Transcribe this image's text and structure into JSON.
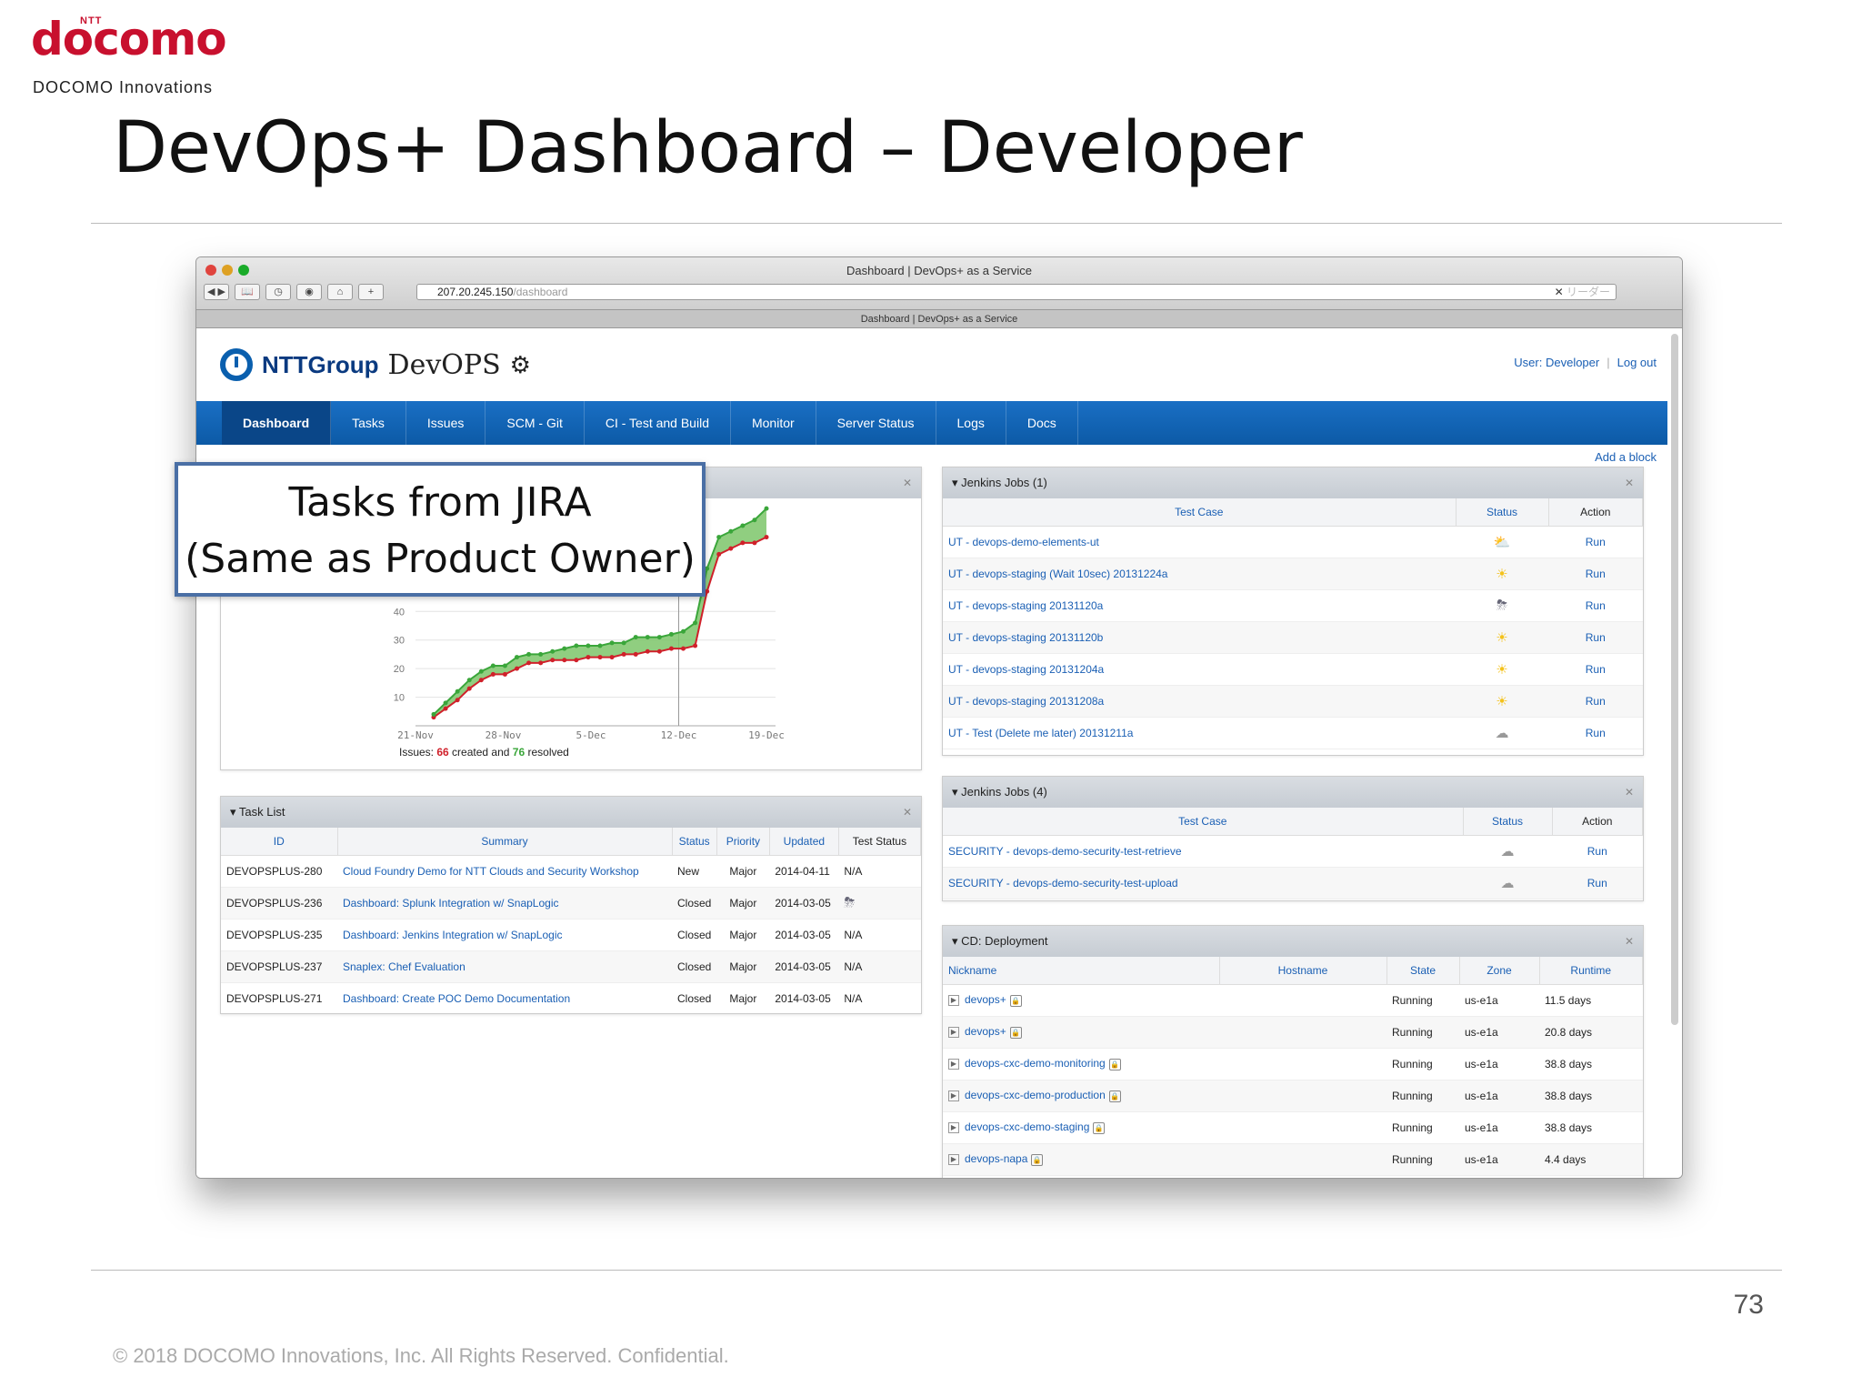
{
  "slide": {
    "logo_small": "NTT",
    "logo": "docomo",
    "logo_sub": "DOCOMO Innovations",
    "title": "DevOps+ Dashboard – Developer",
    "page_number": "73",
    "footer": "© 2018 DOCOMO Innovations, Inc. All Rights Reserved. Confidential."
  },
  "browser": {
    "window_title": "Dashboard | DevOps+ as a Service",
    "url_host": "207.20.245.150",
    "url_path": "/dashboard",
    "tab_title": "Dashboard | DevOps+ as a Service",
    "reader_label": "リーダー"
  },
  "app": {
    "brand_company": "NTTGroup",
    "brand_product": "DevOPS",
    "user_label": "User: Developer",
    "logout_label": "Log out",
    "nav": [
      "Dashboard",
      "Tasks",
      "Issues",
      "SCM - Git",
      "CI - Test and Build",
      "Monitor",
      "Server Status",
      "Logs",
      "Docs"
    ],
    "active_nav": "Dashboard",
    "add_block": "Add a block"
  },
  "callout": {
    "line1": "Tasks from JIRA",
    "line2": "(Same as Product Owner)"
  },
  "issues_chart": {
    "summary_prefix": "Issues: ",
    "created": "66",
    "created_suffix": " created and ",
    "resolved": "76",
    "resolved_suffix": " resolved"
  },
  "chart_data": {
    "type": "area",
    "title": "",
    "x_ticks": [
      "21-Nov",
      "28-Nov",
      "5-Dec",
      "12-Dec",
      "19-Dec"
    ],
    "y_ticks": [
      10,
      20,
      30,
      40
    ],
    "ylim": [
      0,
      50
    ],
    "series": [
      {
        "name": "created",
        "color": "#d0202a",
        "values": [
          3,
          6,
          9,
          13,
          16,
          18,
          18,
          20,
          22,
          22,
          23,
          23,
          23,
          24,
          24,
          24,
          25,
          25,
          26,
          26,
          27,
          27,
          28,
          47,
          60,
          62,
          64,
          64,
          66
        ]
      },
      {
        "name": "resolved",
        "color": "#3aa63a",
        "values": [
          4,
          8,
          12,
          16,
          19,
          21,
          21,
          24,
          25,
          25,
          26,
          27,
          28,
          28,
          28,
          29,
          29,
          31,
          31,
          31,
          32,
          33,
          36,
          55,
          66,
          68,
          70,
          72,
          76
        ]
      }
    ]
  },
  "task_list": {
    "title": "▾ Task List",
    "columns": [
      "ID",
      "Summary",
      "Status",
      "Priority",
      "Updated",
      "Test Status"
    ],
    "rows": [
      {
        "id": "DEVOPSPLUS-280",
        "summary": "Cloud Foundry Demo for NTT Clouds and Security Workshop",
        "status": "New",
        "priority": "Major",
        "updated": "2014-04-11",
        "test": "N/A"
      },
      {
        "id": "DEVOPSPLUS-236",
        "summary": "Dashboard: Splunk Integration w/ SnapLogic",
        "status": "Closed",
        "priority": "Major",
        "updated": "2014-03-05",
        "test": "storm-icon"
      },
      {
        "id": "DEVOPSPLUS-235",
        "summary": "Dashboard: Jenkins Integration w/ SnapLogic",
        "status": "Closed",
        "priority": "Major",
        "updated": "2014-03-05",
        "test": "N/A"
      },
      {
        "id": "DEVOPSPLUS-237",
        "summary": "Snaplex: Chef Evaluation",
        "status": "Closed",
        "priority": "Major",
        "updated": "2014-03-05",
        "test": "N/A"
      },
      {
        "id": "DEVOPSPLUS-271",
        "summary": "Dashboard: Create POC Demo Documentation",
        "status": "Closed",
        "priority": "Major",
        "updated": "2014-03-05",
        "test": "N/A"
      }
    ]
  },
  "jenkins1": {
    "title": "▾ Jenkins Jobs (1)",
    "columns": [
      "Test Case",
      "Status",
      "Action"
    ],
    "rows": [
      {
        "name": "UT - devops-demo-elements-ut",
        "status": "partly-sunny-icon",
        "action": "Run"
      },
      {
        "name": "UT - devops-staging (Wait 10sec) 20131224a",
        "status": "sun-icon",
        "action": "Run"
      },
      {
        "name": "UT - devops-staging 20131120a",
        "status": "storm-icon",
        "action": "Run"
      },
      {
        "name": "UT - devops-staging 20131120b",
        "status": "sun-icon",
        "action": "Run"
      },
      {
        "name": "UT - devops-staging 20131204a",
        "status": "sun-icon",
        "action": "Run"
      },
      {
        "name": "UT - devops-staging 20131208a",
        "status": "sun-icon",
        "action": "Run"
      },
      {
        "name": "UT - Test (Delete me later) 20131211a",
        "status": "cloud-icon",
        "action": "Run"
      }
    ]
  },
  "jenkins4": {
    "title": "▾ Jenkins Jobs (4)",
    "columns": [
      "Test Case",
      "Status",
      "Action"
    ],
    "rows": [
      {
        "name": "SECURITY - devops-demo-security-test-retrieve",
        "status": "cloud-icon",
        "action": "Run"
      },
      {
        "name": "SECURITY - devops-demo-security-test-upload",
        "status": "cloud-icon",
        "action": "Run"
      }
    ]
  },
  "deployment": {
    "title": "▾ CD: Deployment",
    "columns": [
      "Nickname",
      "Hostname",
      "State",
      "Zone",
      "Runtime"
    ],
    "rows": [
      {
        "nickname": "devops+",
        "hostname": "",
        "state": "Running",
        "zone": "us-e1a",
        "runtime": "11.5 days"
      },
      {
        "nickname": "devops+",
        "hostname": "",
        "state": "Running",
        "zone": "us-e1a",
        "runtime": "20.8 days"
      },
      {
        "nickname": "devops-cxc-demo-monitoring",
        "hostname": "",
        "state": "Running",
        "zone": "us-e1a",
        "runtime": "38.8 days"
      },
      {
        "nickname": "devops-cxc-demo-production",
        "hostname": "",
        "state": "Running",
        "zone": "us-e1a",
        "runtime": "38.8 days"
      },
      {
        "nickname": "devops-cxc-demo-staging",
        "hostname": "",
        "state": "Running",
        "zone": "us-e1a",
        "runtime": "38.8 days"
      },
      {
        "nickname": "devops-napa",
        "hostname": "",
        "state": "Running",
        "zone": "us-e1a",
        "runtime": "4.4 days"
      }
    ]
  },
  "colors": {
    "brand_red": "#c8102e",
    "nav_blue": "#0c5aa6",
    "link_blue": "#1a5fb4",
    "callout_border": "#4a6fa5"
  }
}
